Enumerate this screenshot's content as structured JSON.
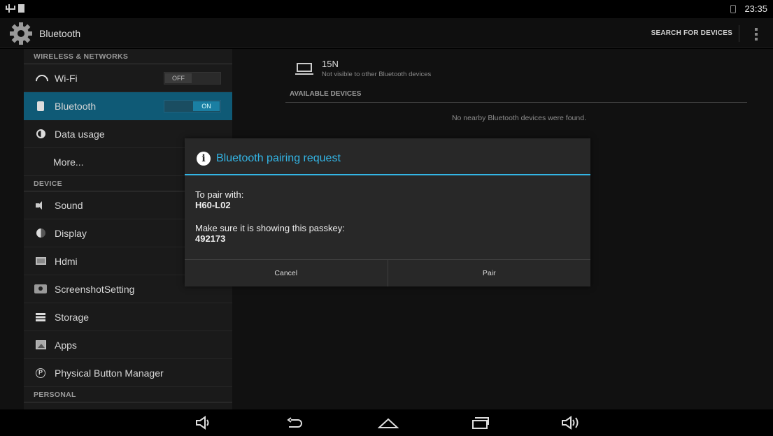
{
  "status_bar": {
    "time": "23:35"
  },
  "action_bar": {
    "title": "Bluetooth",
    "search_label": "SEARCH FOR DEVICES"
  },
  "sidebar": {
    "category_wireless": "WIRELESS & NETWORKS",
    "wifi": {
      "label": "Wi-Fi",
      "toggle": "OFF"
    },
    "bluetooth": {
      "label": "Bluetooth",
      "toggle": "ON"
    },
    "data_usage": {
      "label": "Data usage"
    },
    "more": {
      "label": "More..."
    },
    "category_device": "DEVICE",
    "sound": {
      "label": "Sound"
    },
    "display": {
      "label": "Display"
    },
    "hdmi": {
      "label": "Hdmi"
    },
    "screenshot": {
      "label": "ScreenshotSetting"
    },
    "storage": {
      "label": "Storage"
    },
    "apps": {
      "label": "Apps"
    },
    "physical_button": {
      "label": "Physical Button Manager"
    },
    "category_personal": "PERSONAL"
  },
  "bluetooth_pane": {
    "device_name": "15N",
    "device_status": "Not visible to other Bluetooth devices",
    "available_header": "AVAILABLE DEVICES",
    "no_devices": "No nearby Bluetooth devices were found."
  },
  "dialog": {
    "title": "Bluetooth pairing request",
    "pair_with_label": "To pair with:",
    "device": "H60-L02",
    "passkey_label": "Make sure it is showing this passkey:",
    "passkey": "492173",
    "cancel_label": "Cancel",
    "pair_label": "Pair"
  },
  "colors": {
    "accent": "#33b5e5",
    "selected_bg": "#0f5a76"
  }
}
